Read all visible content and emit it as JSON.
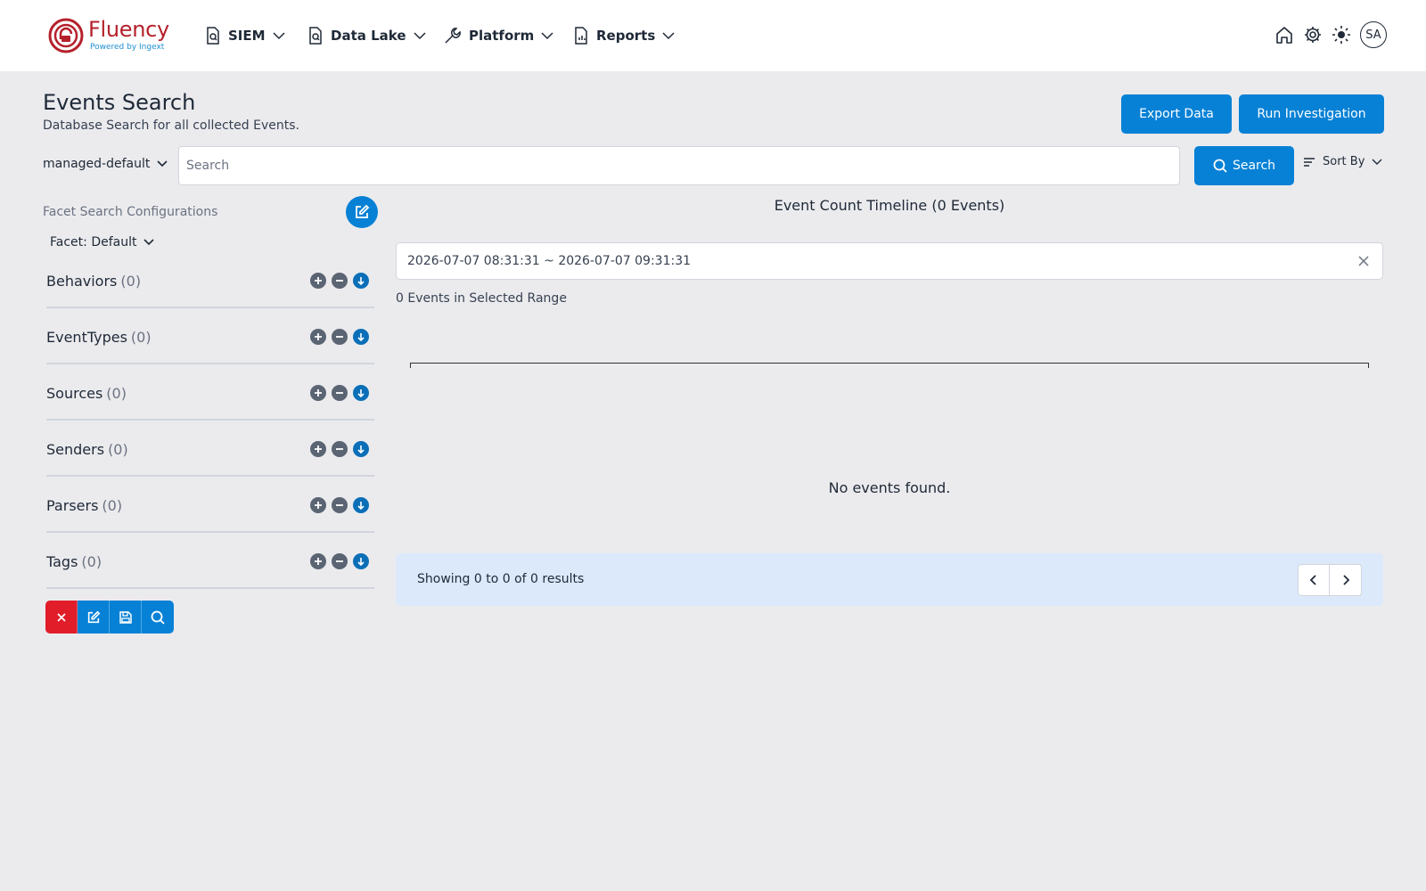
{
  "brand": {
    "name": "Fluency",
    "tagline": "Powered by Ingext"
  },
  "nav": [
    {
      "label": "SIEM",
      "icon": "search-document-icon"
    },
    {
      "label": "Data Lake",
      "icon": "search-document-icon"
    },
    {
      "label": "Platform",
      "icon": "wrench-icon"
    },
    {
      "label": "Reports",
      "icon": "report-icon"
    }
  ],
  "user": {
    "initials": "SA"
  },
  "header": {
    "title": "Events Search",
    "subtitle": "Database Search for all collected Events.",
    "export_label": "Export Data",
    "run_label": "Run Investigation"
  },
  "search": {
    "dataset": "managed-default",
    "placeholder": "Search",
    "value": "",
    "button_label": "Search",
    "sort_label": "Sort By"
  },
  "facets": {
    "config_label": "Facet Search Configurations",
    "selected": "Facet: Default",
    "items": [
      {
        "name": "Behaviors",
        "count": "(0)"
      },
      {
        "name": "EventTypes",
        "count": "(0)"
      },
      {
        "name": "Sources",
        "count": "(0)"
      },
      {
        "name": "Senders",
        "count": "(0)"
      },
      {
        "name": "Parsers",
        "count": "(0)"
      },
      {
        "name": "Tags",
        "count": "(0)"
      }
    ]
  },
  "timeline": {
    "title": "Event Count Timeline (0 Events)",
    "range": "2026-07-07 08:31:31 ~ 2026-07-07 09:31:31",
    "range_summary": "0 Events in Selected Range",
    "empty_message": "No events found."
  },
  "pagination": {
    "text": "Showing 0 to 0 of 0 results"
  },
  "colors": {
    "primary": "#0781d6",
    "danger": "#e11d2a",
    "brand": "#b5212b"
  }
}
